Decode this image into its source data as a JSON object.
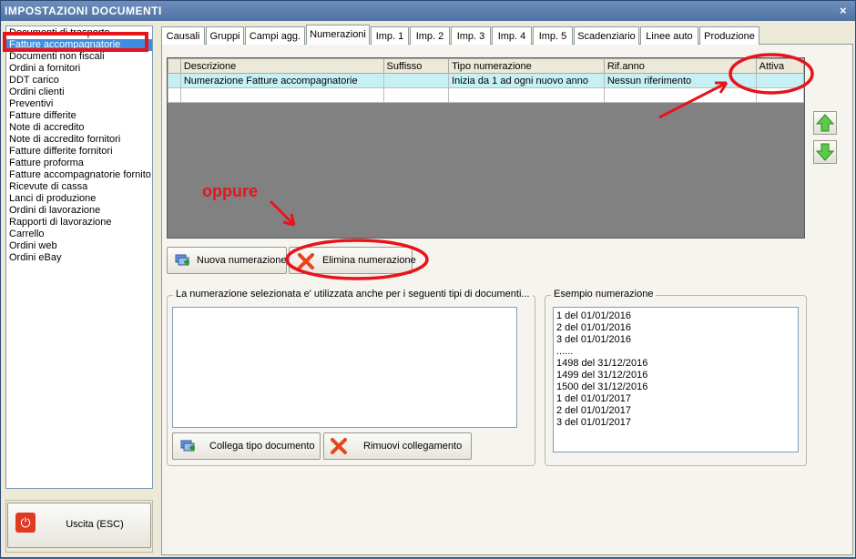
{
  "window": {
    "title": "IMPOSTAZIONI DOCUMENTI",
    "close_glyph": "×"
  },
  "doc_types": [
    {
      "label": "Documenti di trasporto",
      "selected": false
    },
    {
      "label": "Fatture accompagnatorie",
      "selected": true
    },
    {
      "label": "Documenti non fiscali",
      "selected": false
    },
    {
      "label": "Ordini a fornitori",
      "selected": false
    },
    {
      "label": "DDT carico",
      "selected": false
    },
    {
      "label": "Ordini clienti",
      "selected": false
    },
    {
      "label": "Preventivi",
      "selected": false
    },
    {
      "label": "Fatture differite",
      "selected": false
    },
    {
      "label": "Note di accredito",
      "selected": false
    },
    {
      "label": "Note di accredito fornitori",
      "selected": false
    },
    {
      "label": "Fatture differite fornitori",
      "selected": false
    },
    {
      "label": "Fatture proforma",
      "selected": false
    },
    {
      "label": "Fatture accompagnatorie fornito",
      "selected": false
    },
    {
      "label": "Ricevute di cassa",
      "selected": false
    },
    {
      "label": "Lanci di produzione",
      "selected": false
    },
    {
      "label": "Ordini di lavorazione",
      "selected": false
    },
    {
      "label": "Rapporti di lavorazione",
      "selected": false
    },
    {
      "label": "Carrello",
      "selected": false
    },
    {
      "label": "Ordini web",
      "selected": false
    },
    {
      "label": "Ordini eBay",
      "selected": false
    }
  ],
  "exit_button": {
    "label": "Uscita (ESC)",
    "icon": "power-icon"
  },
  "tabs": [
    {
      "label": "Causali",
      "active": false
    },
    {
      "label": "Gruppi",
      "active": false
    },
    {
      "label": "Campi agg.",
      "active": false
    },
    {
      "label": "Numerazioni",
      "active": true
    },
    {
      "label": "Imp. 1",
      "active": false
    },
    {
      "label": "Imp. 2",
      "active": false
    },
    {
      "label": "Imp. 3",
      "active": false
    },
    {
      "label": "Imp. 4",
      "active": false
    },
    {
      "label": "Imp. 5",
      "active": false
    },
    {
      "label": "Scadenziario",
      "active": false
    },
    {
      "label": "Linee auto",
      "active": false
    },
    {
      "label": "Produzione",
      "active": false
    }
  ],
  "grid": {
    "columns": [
      "Descrizione",
      "Suffisso",
      "Tipo numerazione",
      "Rif.anno",
      "Attiva"
    ],
    "rows": [
      [
        "Numerazione Fatture accompagnatorie",
        "",
        "Inizia da 1 ad ogni nuovo anno",
        "Nessun riferimento",
        ""
      ],
      [
        "",
        "",
        "",
        "",
        ""
      ]
    ]
  },
  "buttons": {
    "nuova": "Nuova numerazione",
    "elimina": "Elimina numerazione",
    "collega": "Collega tipo documento",
    "rimuovi": "Rimuovi collegamento"
  },
  "linked_group": {
    "title": "La numerazione selezionata e' utilizzata anche per i seguenti tipi di documenti..."
  },
  "example_group": {
    "title": "Esempio numerazione",
    "lines": [
      "1 del 01/01/2016",
      "2 del 01/01/2016",
      "3 del 01/01/2016",
      "......",
      "1498 del 31/12/2016",
      "1499 del 31/12/2016",
      "1500 del 31/12/2016",
      "1 del 01/01/2017",
      "2 del 01/01/2017",
      "3 del 01/01/2017"
    ]
  },
  "annotation": {
    "text": "oppure",
    "color": "#e8141b"
  },
  "colors": {
    "selection": "#3d8ee0",
    "row_highlight": "#c6f0f4",
    "grid_bg": "#818181",
    "annotation_red": "#e8141b"
  }
}
